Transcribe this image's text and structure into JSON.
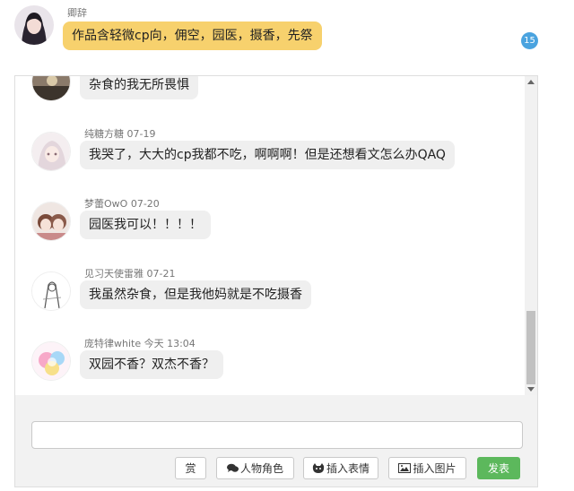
{
  "top_post": {
    "username": "卿辞",
    "message": "作品含轻微cp向，佣空，园医，摄香，先祭",
    "reply_count": "15"
  },
  "comments": [
    {
      "username": "",
      "date": "",
      "message": "杂食的我无所畏惧"
    },
    {
      "username": "纯糖方糖",
      "date": "07-19",
      "message": "我哭了，大大的cp我都不吃，啊啊啊！但是还想看文怎么办QAQ"
    },
    {
      "username": "梦蕾OwO",
      "date": "07-20",
      "message": "园医我可以！！！！"
    },
    {
      "username": "见习天使雷雅",
      "date": "07-21",
      "message": "我虽然杂食，但是我他妈就是不吃摄香"
    },
    {
      "username": "庞特律white",
      "date": "今天 13:04",
      "message": "双园不香？双杰不香？"
    }
  ],
  "reply_box": {
    "placeholder": ""
  },
  "toolbar": {
    "reward_label": "赏",
    "character_label": "人物角色",
    "emoji_label": "插入表情",
    "image_label": "插入图片",
    "send_label": "发表"
  },
  "colors": {
    "accent_yellow": "#f7d16d",
    "badge_blue": "#4aa3df",
    "send_green": "#5cb85c"
  }
}
